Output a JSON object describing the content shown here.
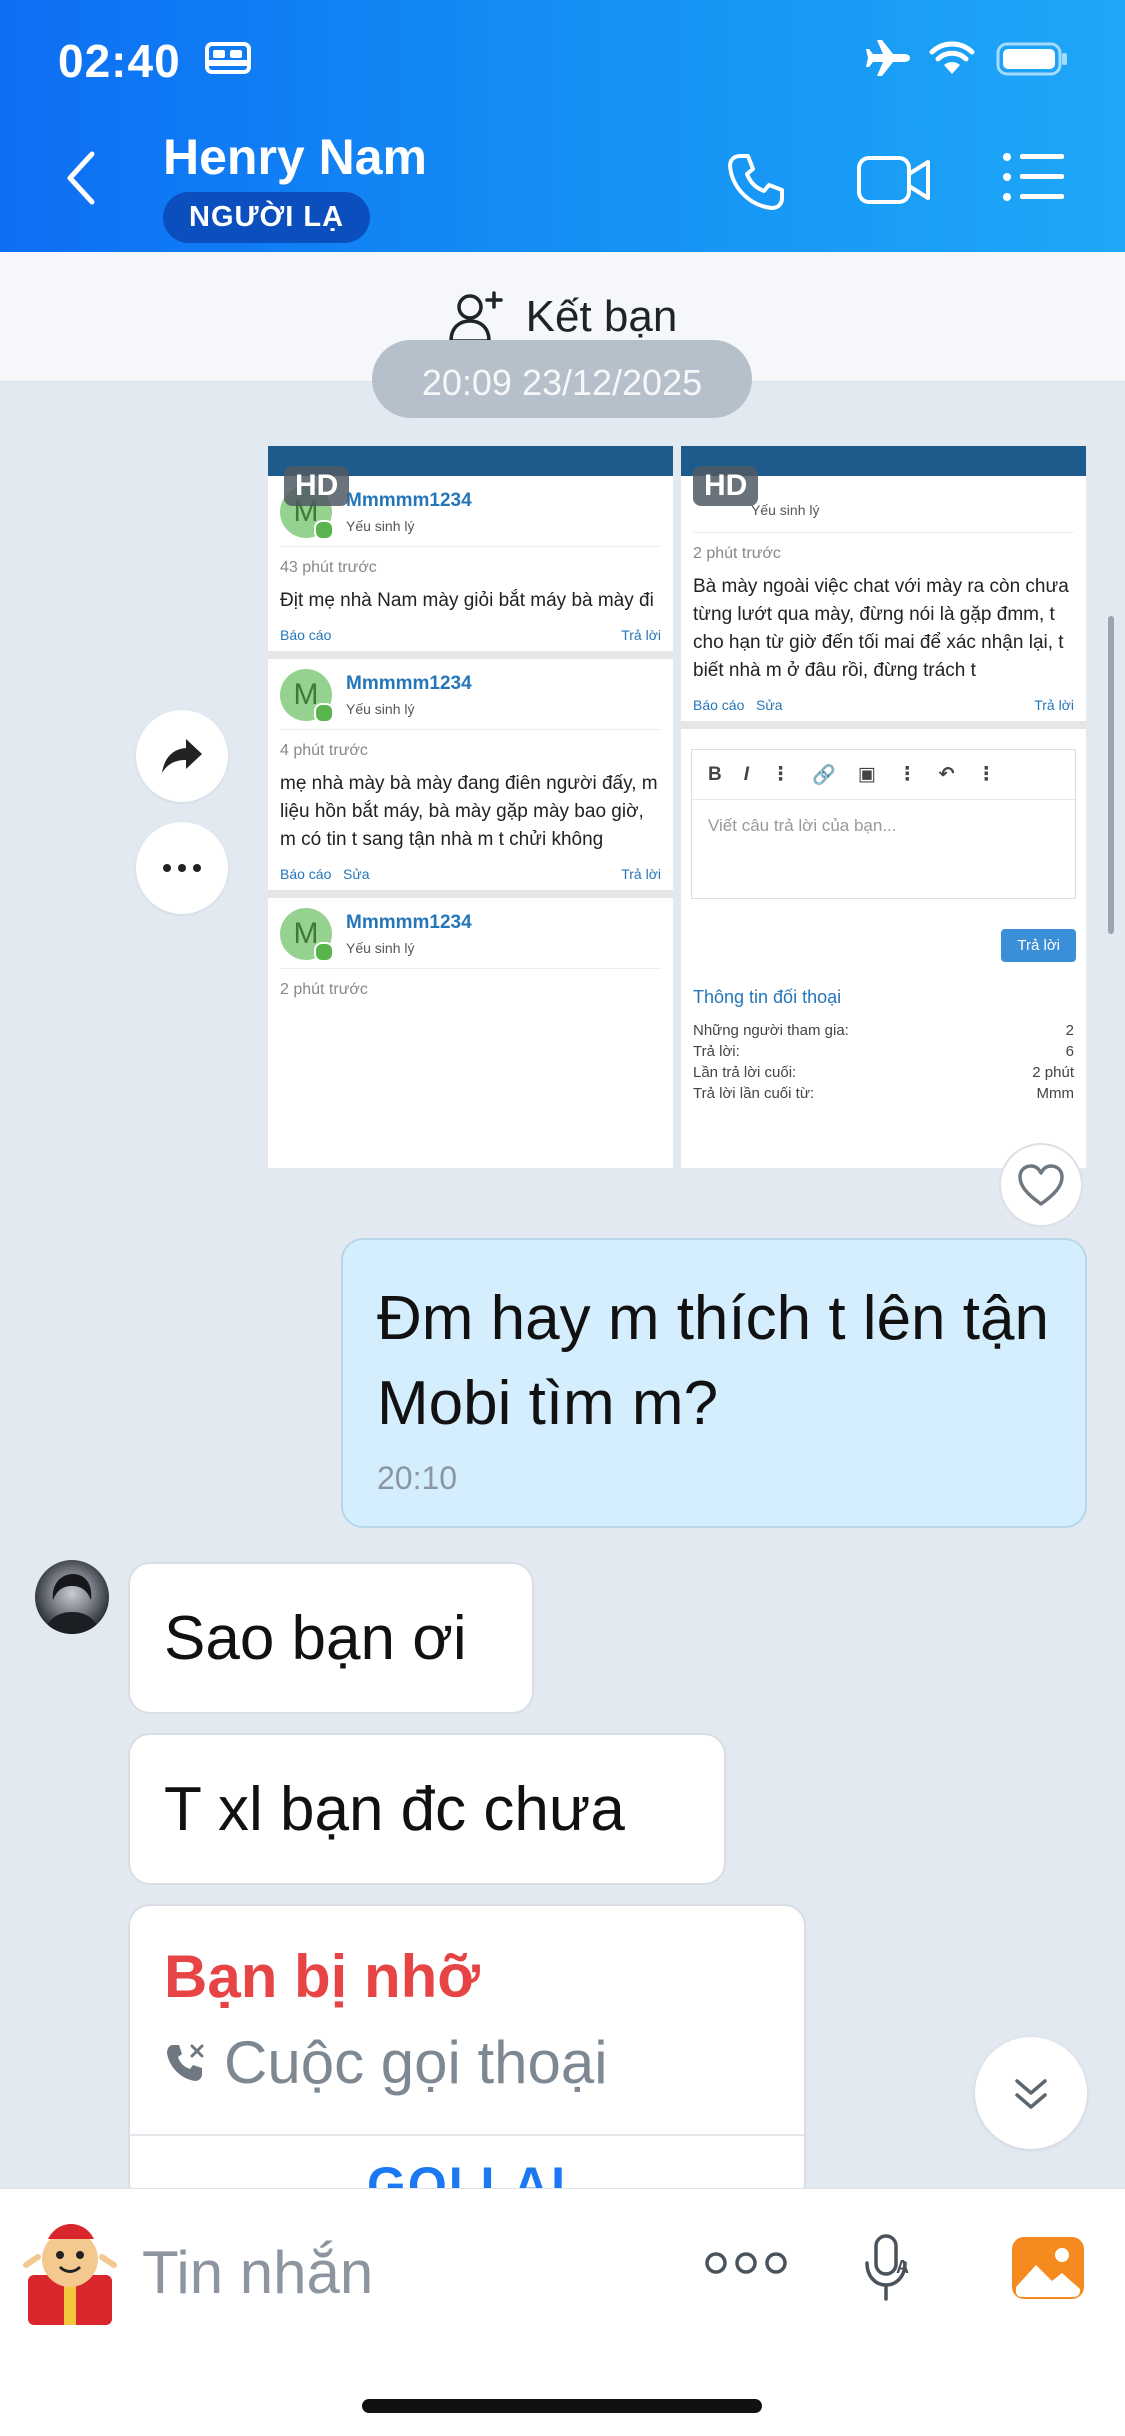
{
  "status_bar": {
    "time": "02:40"
  },
  "header": {
    "contact_name": "Henry Nam",
    "badge": "NGƯỜI LẠ"
  },
  "add_friend": {
    "label": "Kết bạn"
  },
  "date_chip": "20:09 23/12/2025",
  "images": {
    "hd_label": "HD",
    "left_posts": [
      {
        "user": "Mmmmm1234",
        "role": "Yếu sinh lý",
        "time": "43 phút trước",
        "text": "Địt mẹ nhà Nam mày giỏi bắt máy bà mày đi",
        "report": "Báo cáo",
        "edit": "",
        "reply": "Trả lời"
      },
      {
        "user": "Mmmmm1234",
        "role": "Yếu sinh lý",
        "time": "4 phút trước",
        "text": "mẹ nhà mày bà mày đang điên người đấy, m liệu hồn bắt máy, bà mày gặp mày bao giờ, m có tin t sang tận nhà m t chửi không",
        "report": "Báo cáo",
        "edit": "Sửa",
        "reply": "Trả lời"
      },
      {
        "user": "Mmmmm1234",
        "role": "Yếu sinh lý",
        "time": "2 phút trước",
        "text": "",
        "report": "",
        "edit": "",
        "reply": ""
      }
    ],
    "right_post": {
      "role": "Yếu sinh lý",
      "time": "2 phút trước",
      "text": "Bà mày ngoài việc chat với mày ra còn chưa từng lướt qua mày, đừng nói là gặp đmm, t cho hạn từ giờ đến tối mai để xác nhận lại, t biết nhà m ở đâu rồi, đừng trách t",
      "report": "Báo cáo",
      "edit": "Sửa",
      "reply": "Trả lời"
    },
    "editor_placeholder": "Viết câu trả lời của bạn...",
    "editor_reply": "Trả lời",
    "info_title": "Thông tin đối thoại",
    "info_rows": [
      {
        "k": "Những người tham gia:",
        "v": "2"
      },
      {
        "k": "Trả lời:",
        "v": "6"
      },
      {
        "k": "Lần trả lời cuối:",
        "v": "2 phút"
      },
      {
        "k": "Trả lời lần cuối từ:",
        "v": "Mmm"
      }
    ]
  },
  "messages": {
    "outgoing": {
      "text": "Đm hay m thích t lên tận Mobi tìm m?",
      "time": "20:10"
    },
    "incoming_1": "Sao bạn ơi",
    "incoming_2": "T xl bạn đc chưa",
    "missed_call": {
      "title": "Bạn bị nhỡ",
      "subtitle": "Cuộc gọi thoại",
      "action": "GỌI LẠI"
    }
  },
  "composer": {
    "placeholder": "Tin nhắn"
  },
  "colors": {
    "header_start": "#0d6ef3",
    "header_end": "#1ea7f7",
    "missed": "#e74545",
    "callback": "#1a78f2",
    "outgoing_bubble": "#d5eefd"
  }
}
